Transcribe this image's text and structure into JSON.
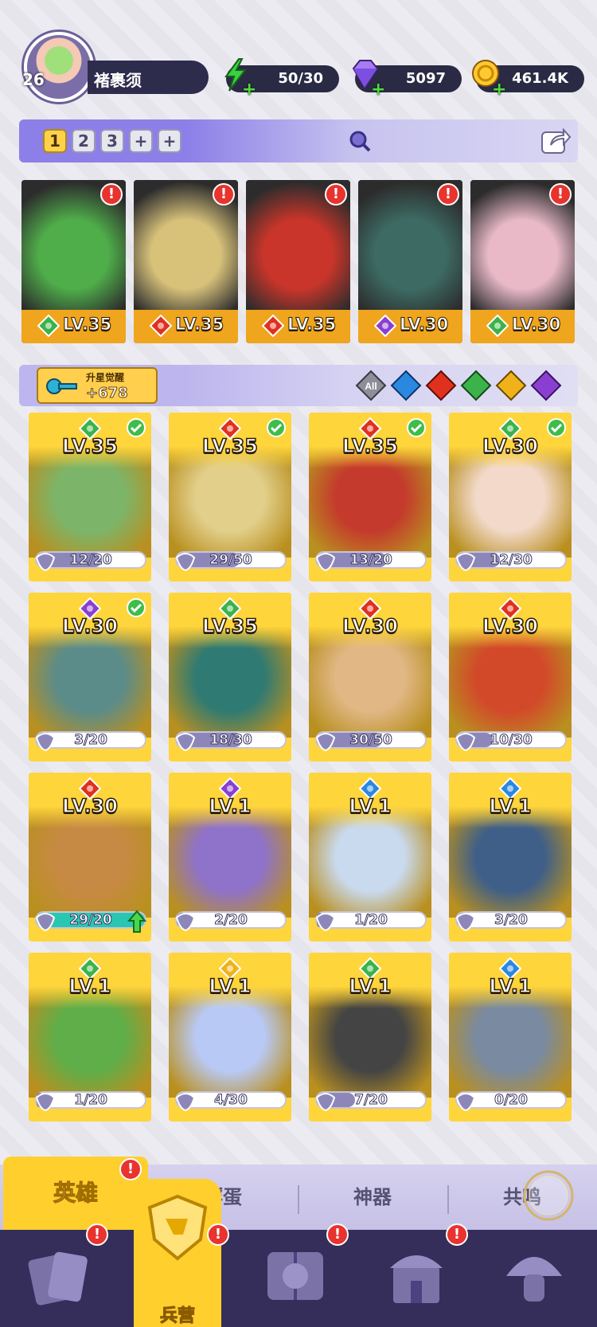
{
  "player": {
    "level": "26",
    "name": "褚裹须"
  },
  "resources": {
    "energy": "50/30",
    "gems": "5097",
    "gold": "461.4K"
  },
  "team": {
    "slots": [
      "1",
      "2",
      "3",
      "+",
      "+"
    ],
    "heroes": [
      {
        "level": "LV.35",
        "element": "nature",
        "color": "#4fae4a"
      },
      {
        "level": "LV.35",
        "element": "fire",
        "color": "#d8c27a"
      },
      {
        "level": "LV.35",
        "element": "fire",
        "color": "#c9352a"
      },
      {
        "level": "LV.30",
        "element": "dark",
        "color": "#3d6b63"
      },
      {
        "level": "LV.30",
        "element": "nature",
        "color": "#e9b9c8"
      }
    ]
  },
  "filter": {
    "key_title": "升星觉醒",
    "key_value": "+678",
    "all_label": "All"
  },
  "heroes": [
    {
      "level": "LV.35",
      "element": "nature",
      "count": "12/20",
      "progress": 0.6,
      "checked": true,
      "color": "#7cb56a"
    },
    {
      "level": "LV.35",
      "element": "fire",
      "count": "29/50",
      "progress": 0.58,
      "checked": true,
      "color": "#e2cf8a"
    },
    {
      "level": "LV.35",
      "element": "fire",
      "count": "13/20",
      "progress": 0.65,
      "checked": true,
      "color": "#c43a2c"
    },
    {
      "level": "LV.30",
      "element": "nature",
      "count": "12/30",
      "progress": 0.4,
      "checked": true,
      "color": "#f2d9c9"
    },
    {
      "level": "LV.30",
      "element": "dark",
      "count": "3/20",
      "progress": 0.15,
      "checked": true,
      "color": "#5b8c8a"
    },
    {
      "level": "LV.35",
      "element": "nature",
      "count": "18/30",
      "progress": 0.6,
      "checked": false,
      "color": "#2f7a73"
    },
    {
      "level": "LV.30",
      "element": "fire",
      "count": "30/50",
      "progress": 0.6,
      "checked": false,
      "color": "#e1b785"
    },
    {
      "level": "LV.30",
      "element": "fire",
      "count": "10/30",
      "progress": 0.33,
      "checked": false,
      "color": "#d2492a"
    },
    {
      "level": "LV.30",
      "element": "fire",
      "count": "29/20",
      "progress": 1.0,
      "checked": false,
      "color": "#c78a44",
      "upgrade": true
    },
    {
      "level": "LV.1",
      "element": "dark",
      "count": "2/20",
      "progress": 0.1,
      "checked": false,
      "color": "#8f72c9"
    },
    {
      "level": "LV.1",
      "element": "water",
      "count": "1/20",
      "progress": 0.05,
      "checked": false,
      "color": "#c9d9ee"
    },
    {
      "level": "LV.1",
      "element": "water",
      "count": "3/20",
      "progress": 0.15,
      "checked": false,
      "color": "#3f5f88"
    },
    {
      "level": "LV.1",
      "element": "nature",
      "count": "1/20",
      "progress": 0.05,
      "checked": false,
      "color": "#5fae4a"
    },
    {
      "level": "LV.1",
      "element": "light",
      "count": "4/30",
      "progress": 0.13,
      "checked": false,
      "color": "#b9c9f5"
    },
    {
      "level": "LV.1",
      "element": "nature",
      "count": "7/20",
      "progress": 0.35,
      "checked": false,
      "color": "#444"
    },
    {
      "level": "LV.1",
      "element": "water",
      "count": "0/20",
      "progress": 0.0,
      "checked": false,
      "color": "#7a8aa0"
    }
  ],
  "subtabs": [
    "英雄",
    "孵蛋",
    "神器",
    "共鸣"
  ],
  "nav": {
    "barracks_label": "兵营"
  },
  "element_colors": {
    "nature": "#3bb34a",
    "fire": "#e0311f",
    "dark": "#8b3fd0",
    "water": "#2a88e0",
    "light": "#f0b21a"
  }
}
